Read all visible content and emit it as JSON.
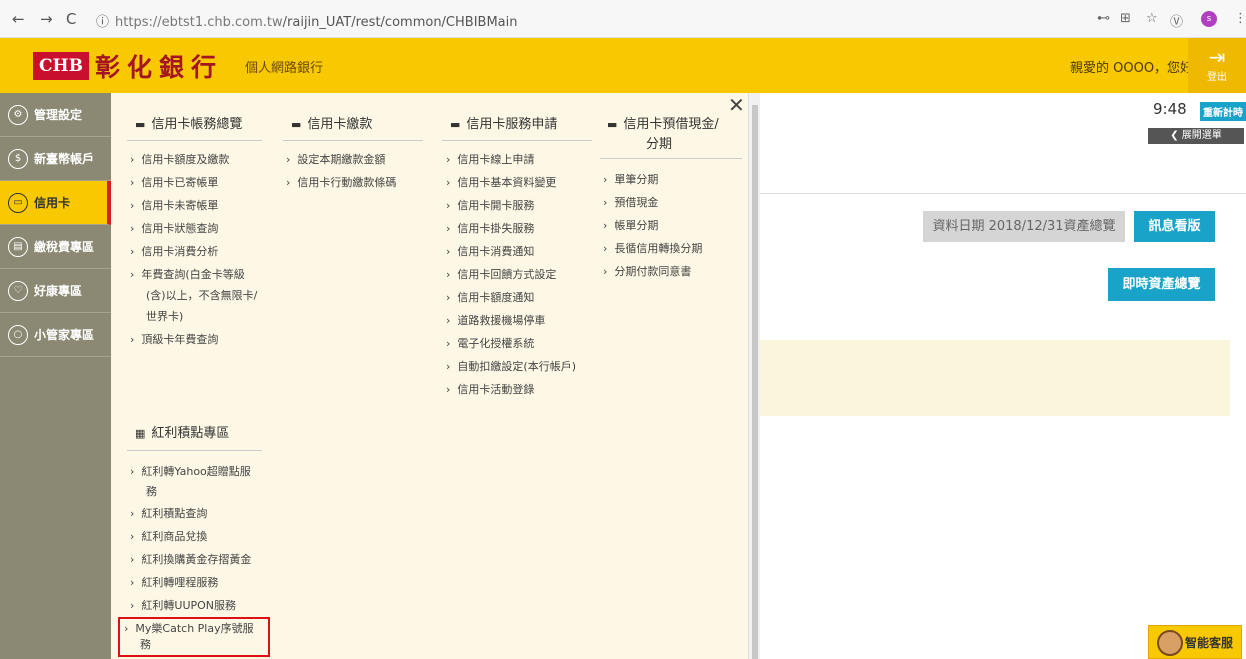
{
  "browser": {
    "url_host": "https://ebtst1.chb.com.tw",
    "url_path": "/raijin_UAT/rest/common/CHBIBMain",
    "info_icon": "info-icon",
    "profile_letter": "s"
  },
  "header": {
    "logo_mark": "CHB",
    "bank_name": "彰化銀行",
    "subtitle": "個人網路銀行",
    "greeting": "親愛的 OOOO，您好",
    "logout_label": "登出"
  },
  "sidebar": {
    "items": [
      {
        "label": "管理設定",
        "icon": "gear-icon"
      },
      {
        "label": "新臺幣帳戶",
        "icon": "dollar-icon"
      },
      {
        "label": "信用卡",
        "icon": "credit-card-icon"
      },
      {
        "label": "繳稅費專區",
        "icon": "bill-icon"
      },
      {
        "label": "好康專區",
        "icon": "heart-icon"
      },
      {
        "label": "小管家專區",
        "icon": "helper-icon"
      }
    ]
  },
  "menu": {
    "col1_title": "信用卡帳務總覽",
    "col1_items": [
      "信用卡額度及繳款",
      "信用卡已寄帳單",
      "信用卡未寄帳單",
      "信用卡狀態查詢",
      "信用卡消費分析",
      "年費查詢(白金卡等級",
      "(含)以上，不含無限卡/",
      "世界卡)",
      "頂級卡年費查詢"
    ],
    "col2_title": "信用卡繳款",
    "col2_items": [
      "設定本期繳款金額",
      "信用卡行動繳款條碼"
    ],
    "col3_title": "信用卡服務申請",
    "col3_items": [
      "信用卡線上申請",
      "信用卡基本資料變更",
      "信用卡開卡服務",
      "信用卡掛失服務",
      "信用卡消費通知",
      "信用卡回饋方式設定",
      "信用卡額度通知",
      "道路救援機場停車",
      "電子化授權系統",
      "自動扣繳設定(本行帳戶)",
      "信用卡活動登錄"
    ],
    "col4_title_1": "信用卡預借現金/",
    "col4_title_2": "分期",
    "col4_items": [
      "單筆分期",
      "預借現金",
      "帳單分期",
      "長循信用轉換分期",
      "分期付款同意書"
    ],
    "bonus_title": "紅利積點專區",
    "bonus_items": [
      "紅利轉Yahoo超贈點服",
      "務",
      "紅利積點查詢",
      "紅利商品兌換",
      "紅利換購黃金存摺黃金",
      "紅利轉哩程服務",
      "紅利轉UUPON服務"
    ],
    "highlight_1": "My樂Catch Play序號服",
    "highlight_2": "務"
  },
  "main": {
    "timer": "9:48",
    "reset_label": "重新計時",
    "expand_label": "展開選單",
    "date_button": "資料日期 2018/12/31資產總覽",
    "message_button": "訊息看版",
    "realtime_button": "即時資產總覽",
    "chat_label": "智能客服"
  }
}
